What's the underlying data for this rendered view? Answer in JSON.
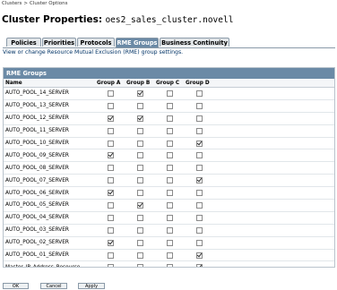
{
  "breadcrumb": {
    "items": [
      "Clusters",
      "Cluster Options"
    ],
    "separator": ">"
  },
  "title": {
    "label": "Cluster Properties:",
    "value": "oes2_sales_cluster.novell"
  },
  "tabs": [
    {
      "label": "Policies",
      "active": false
    },
    {
      "label": "Priorities",
      "active": false
    },
    {
      "label": "Protocols",
      "active": false
    },
    {
      "label": "RME Groups",
      "active": true
    },
    {
      "label": "Business Continuity",
      "active": false
    }
  ],
  "description": "View or change Resource Mutual Exclusion (RME) group settings.",
  "panel": {
    "title": "RME Groups",
    "columns": [
      "Name",
      "Group A",
      "Group B",
      "Group C",
      "Group D"
    ],
    "rows": [
      {
        "name": "AUTO_POOL_14_SERVER",
        "checks": [
          false,
          true,
          false,
          false
        ]
      },
      {
        "name": "AUTO_POOL_13_SERVER",
        "checks": [
          false,
          false,
          false,
          false
        ]
      },
      {
        "name": "AUTO_POOL_12_SERVER",
        "checks": [
          true,
          true,
          false,
          false
        ]
      },
      {
        "name": "AUTO_POOL_11_SERVER",
        "checks": [
          false,
          false,
          false,
          false
        ]
      },
      {
        "name": "AUTO_POOL_10_SERVER",
        "checks": [
          false,
          false,
          false,
          true
        ]
      },
      {
        "name": "AUTO_POOL_09_SERVER",
        "checks": [
          true,
          false,
          false,
          false
        ]
      },
      {
        "name": "AUTO_POOL_08_SERVER",
        "checks": [
          false,
          false,
          false,
          false
        ]
      },
      {
        "name": "AUTO_POOL_07_SERVER",
        "checks": [
          false,
          false,
          false,
          true
        ]
      },
      {
        "name": "AUTO_POOL_06_SERVER",
        "checks": [
          true,
          false,
          false,
          false
        ]
      },
      {
        "name": "AUTO_POOL_05_SERVER",
        "checks": [
          false,
          true,
          false,
          false
        ]
      },
      {
        "name": "AUTO_POOL_04_SERVER",
        "checks": [
          false,
          false,
          false,
          false
        ]
      },
      {
        "name": "AUTO_POOL_03_SERVER",
        "checks": [
          false,
          false,
          false,
          false
        ]
      },
      {
        "name": "AUTO_POOL_02_SERVER",
        "checks": [
          true,
          false,
          false,
          false
        ]
      },
      {
        "name": "AUTO_POOL_01_SERVER",
        "checks": [
          false,
          false,
          false,
          true
        ]
      },
      {
        "name": "Master_IP_Address_Resource",
        "checks": [
          false,
          false,
          false,
          true
        ]
      }
    ]
  },
  "buttons": {
    "ok": "OK",
    "cancel": "Cancel",
    "apply": "Apply"
  },
  "colors": {
    "accent": "#6b8aa6",
    "description_text": "#003366"
  }
}
